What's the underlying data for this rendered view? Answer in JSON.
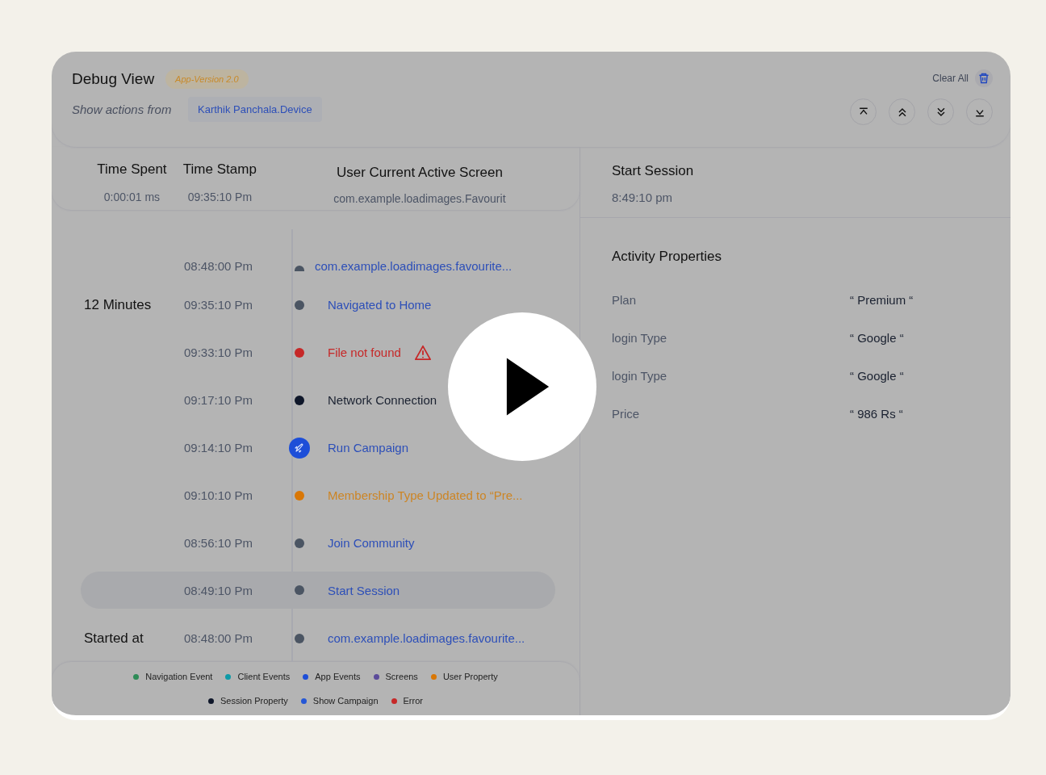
{
  "header": {
    "title": "Debug View",
    "version_badge": "App-Version 2.0",
    "source_label": "Show  actions from",
    "device": "Karthik Panchala.Device",
    "clear_label": "Clear All"
  },
  "summary": {
    "columns": [
      {
        "heading": "Time Spent",
        "value": "0:00:01 ms"
      },
      {
        "heading": "Time Stamp",
        "value": "09:35:10 Pm"
      },
      {
        "heading": "User Current Active Screen",
        "value": "com.example.loadimages.Favourit"
      }
    ]
  },
  "timeline": [
    {
      "time": "08:48:00 Pm",
      "text": "com.example.loadimages.favourite...",
      "kind": "screen_start",
      "color": "#4b5563",
      "selected": false
    },
    {
      "time": "09:35:10 Pm",
      "text": "Navigated to Home",
      "kind": "screen",
      "color": "#4b5563",
      "selected": false,
      "side_label": "12 Minutes"
    },
    {
      "time": "09:33:10 Pm",
      "text": "File not found",
      "kind": "error",
      "color": "#c62828",
      "selected": false,
      "warning": true
    },
    {
      "time": "09:17:10 Pm",
      "text": "Network Connection",
      "kind": "session",
      "color": "#0f172a",
      "selected": false
    },
    {
      "time": "09:14:10 Pm",
      "text": "Run Campaign",
      "kind": "campaign",
      "color": "#1d4ed8",
      "selected": false
    },
    {
      "time": "09:10:10 Pm",
      "text": "Membership Type  Updated to “Pre...",
      "kind": "property",
      "color": "#d97706",
      "selected": false
    },
    {
      "time": "08:56:10 Pm",
      "text": "Join Community",
      "kind": "screen",
      "color": "#4b5563",
      "selected": false
    },
    {
      "time": "08:49:10 Pm",
      "text": "Start Session",
      "kind": "screen",
      "color": "#4b5563",
      "selected": true
    },
    {
      "time": "08:48:00 Pm",
      "text": "com.example.loadimages.favourite...",
      "kind": "screen",
      "color": "#4b5563",
      "selected": false,
      "side_label": "Started at"
    }
  ],
  "legend": [
    {
      "label": "Navigation Event",
      "color": "#2e8b57"
    },
    {
      "label": "Client Events",
      "color": "#0e9aa7"
    },
    {
      "label": "App Events",
      "color": "#1d4ed8"
    },
    {
      "label": "Screens",
      "color": "#5b4b9a"
    },
    {
      "label": "User Property",
      "color": "#d97706"
    },
    {
      "label": "Session Property",
      "color": "#0f172a"
    },
    {
      "label": "Show Campaign",
      "color": "#2557d6"
    },
    {
      "label": "Error",
      "color": "#c62828"
    }
  ],
  "session": {
    "title": "Start Session",
    "time": "8:49:10 pm"
  },
  "activity": {
    "title": "Activity Properties",
    "rows": [
      {
        "label": "Plan",
        "value": "“ Premium “"
      },
      {
        "label": "login Type",
        "value": "“ Google “"
      },
      {
        "label": "login Type",
        "value": "“ Google “"
      },
      {
        "label": "Price",
        "value": "“ 986 Rs “"
      }
    ]
  }
}
